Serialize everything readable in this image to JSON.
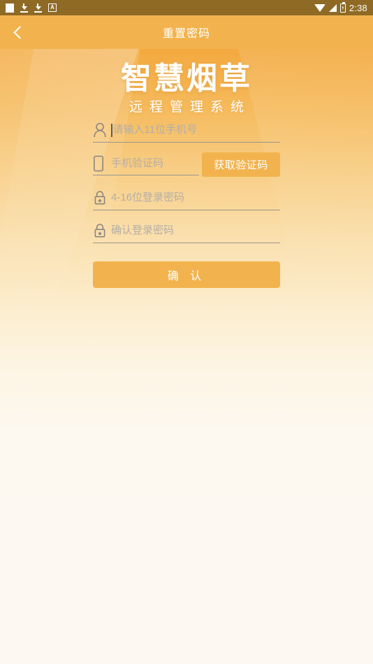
{
  "status_bar": {
    "time": "2:38",
    "left_icons": [
      "app-square-icon",
      "download-icon",
      "download-icon",
      "letter-a-box-icon"
    ],
    "right_icons": [
      "wifi-icon",
      "signal-icon",
      "battery-charging-icon"
    ],
    "background_color": "#8E6A25"
  },
  "app_bar": {
    "title": "重置密码",
    "back_icon": "chevron-left-icon",
    "background_color": "#F2B34E"
  },
  "logo": {
    "main": "智慧烟草",
    "sub": "远程管理系统"
  },
  "form": {
    "phone": {
      "icon": "user-icon",
      "placeholder": "请输入11位手机号",
      "value": ""
    },
    "code": {
      "icon": "phone-icon",
      "placeholder": "手机验证码",
      "value": "",
      "button_label": "获取验证码"
    },
    "password": {
      "icon": "lock-icon",
      "placeholder": "4-16位登录密码",
      "value": ""
    },
    "confirm_password": {
      "icon": "lock-icon",
      "placeholder": "确认登录密码",
      "value": ""
    },
    "submit_label": "确 认"
  },
  "colors": {
    "accent": "#F2B34E",
    "status_bar": "#8E6A25",
    "page_bottom": "#FDF8F0",
    "placeholder": "#B3AEA8",
    "underline": "#9A958E"
  }
}
